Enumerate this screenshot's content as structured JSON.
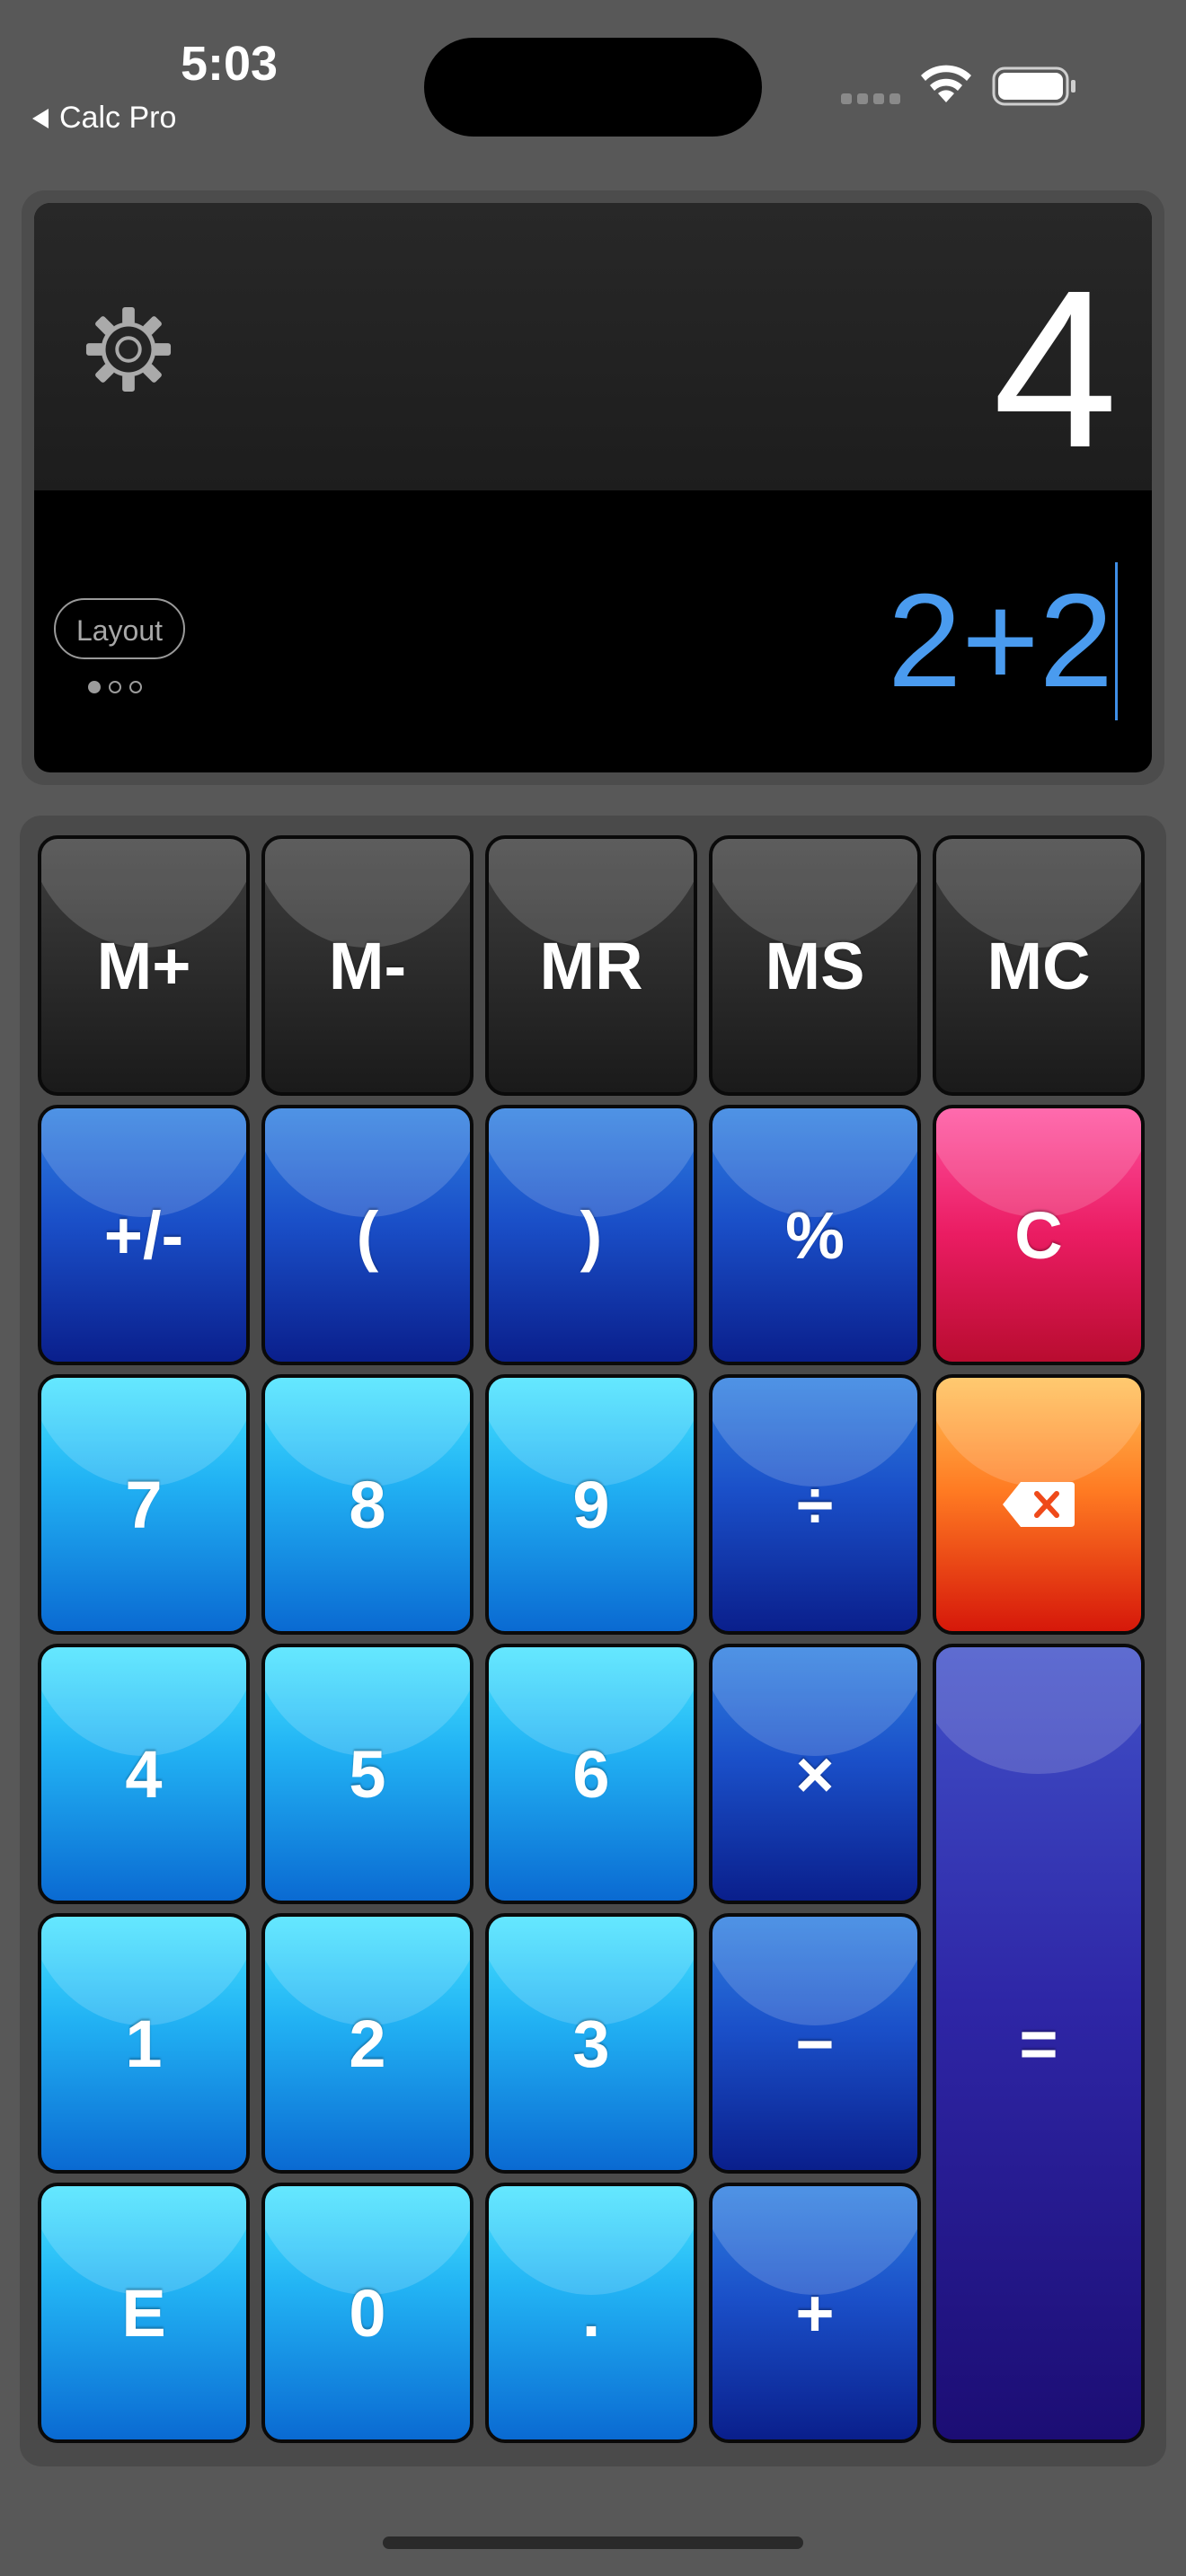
{
  "status_bar": {
    "time": "5:03",
    "back_label": "Calc Pro"
  },
  "display": {
    "result": "4",
    "expression": "2+2",
    "layout_button": "Layout",
    "page_count": 3,
    "active_page": 1
  },
  "keypad": {
    "memory": {
      "m_plus": "M+",
      "m_minus": "M-",
      "mr": "MR",
      "ms": "MS",
      "mc": "MC"
    },
    "row2": {
      "plus_minus": "+/-",
      "open_paren": "(",
      "close_paren": ")",
      "percent": "%",
      "clear": "C"
    },
    "row3": {
      "seven": "7",
      "eight": "8",
      "nine": "9",
      "divide": "÷"
    },
    "row4": {
      "four": "4",
      "five": "5",
      "six": "6",
      "multiply": "×"
    },
    "row5": {
      "one": "1",
      "two": "2",
      "three": "3",
      "minus": "−"
    },
    "row6": {
      "exp": "E",
      "zero": "0",
      "dot": ".",
      "plus": "+"
    },
    "equals": "="
  },
  "icons": {
    "settings": "gear-icon",
    "backspace": "backspace-icon",
    "wifi": "wifi-icon",
    "battery": "battery-icon"
  },
  "colors": {
    "result_text": "#ffffff",
    "expression_text": "#4a9bef",
    "number_key": "#22b3f4",
    "operator_key": "#1a4fc8",
    "clear_key": "#ea1c62",
    "backspace_key": "#ff7a22",
    "equals_key": "#2e26a6",
    "memory_key": "#2a2a2a"
  }
}
